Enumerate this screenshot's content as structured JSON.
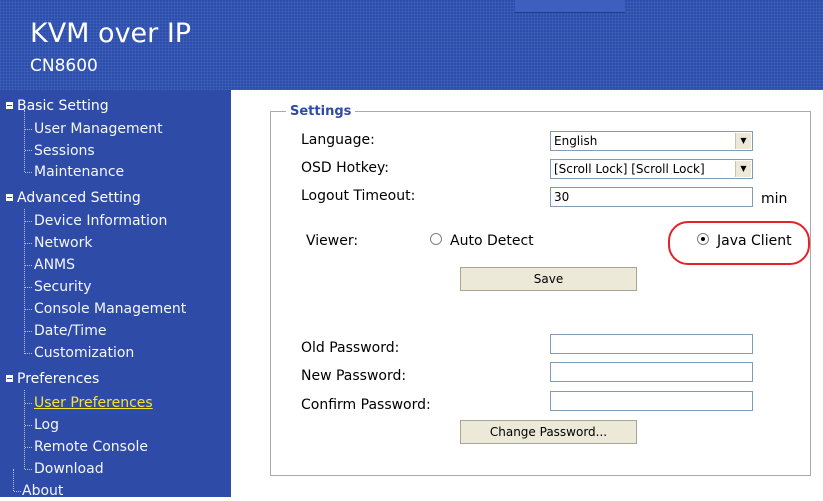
{
  "header": {
    "title": "KVM over IP",
    "subtitle": "CN8600"
  },
  "sidebar": {
    "sections": [
      {
        "label": "Basic Setting",
        "items": [
          {
            "label": "User Management"
          },
          {
            "label": "Sessions"
          },
          {
            "label": "Maintenance"
          }
        ]
      },
      {
        "label": "Advanced Setting",
        "items": [
          {
            "label": "Device Information"
          },
          {
            "label": "Network"
          },
          {
            "label": "ANMS"
          },
          {
            "label": "Security"
          },
          {
            "label": "Console Management"
          },
          {
            "label": "Date/Time"
          },
          {
            "label": "Customization"
          }
        ]
      },
      {
        "label": "Preferences",
        "items": [
          {
            "label": "User Preferences",
            "active": true
          },
          {
            "label": "Log"
          },
          {
            "label": "Remote Console"
          },
          {
            "label": "Download"
          }
        ]
      }
    ],
    "about": "About"
  },
  "settings": {
    "legend": "Settings",
    "language": {
      "label": "Language:",
      "value": "English"
    },
    "osd_hotkey": {
      "label": "OSD Hotkey:",
      "value": "[Scroll Lock] [Scroll Lock]"
    },
    "logout_timeout": {
      "label": "Logout Timeout:",
      "value": "30",
      "unit": "min"
    },
    "viewer": {
      "label": "Viewer:",
      "options": [
        {
          "label": "Auto Detect",
          "selected": false
        },
        {
          "label": "Java Client",
          "selected": true
        }
      ]
    },
    "save_label": "Save"
  },
  "password": {
    "old_label": "Old Password:",
    "new_label": "New Password:",
    "confirm_label": "Confirm Password:",
    "old_value": "",
    "new_value": "",
    "confirm_value": "",
    "change_label": "Change Password..."
  },
  "colors": {
    "header_bg": "#2c4fae",
    "sidebar_bg": "#2e4ba8",
    "active_link": "#f5e62d",
    "highlight": "#e3222a"
  }
}
